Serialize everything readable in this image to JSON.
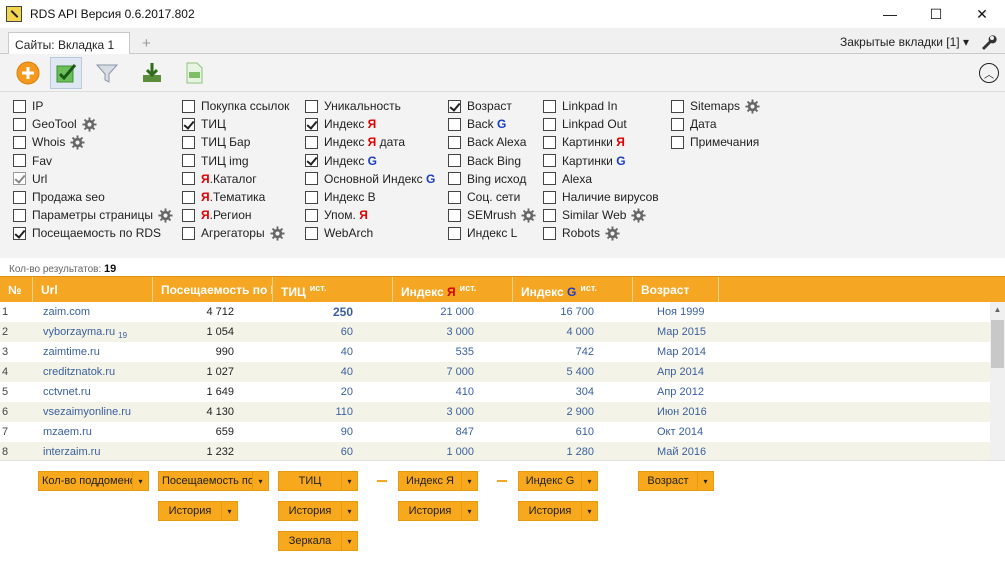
{
  "window": {
    "title": "RDS API Версия 0.6.2017.802",
    "minimize": "—",
    "maximize": "☐",
    "close": "✕"
  },
  "tabs": {
    "active": "Сайты:  Вкладка 1",
    "new_tab": "+",
    "closed_tabs": "Закрытые вкладки [1] ▾"
  },
  "options": {
    "col1": [
      {
        "label": "IP",
        "checked": false
      },
      {
        "label": "GeoTool",
        "checked": false,
        "gear": true
      },
      {
        "label": "Whois",
        "checked": false,
        "gear": true
      },
      {
        "label": "Fav",
        "checked": false
      },
      {
        "label": "Url",
        "checked": true,
        "disabled": true
      },
      {
        "label": "Продажа seo",
        "checked": false
      },
      {
        "label": "Параметры страницы",
        "checked": false,
        "gear": true
      },
      {
        "label": "Посещаемость по RDS",
        "checked": true
      }
    ],
    "col2": [
      {
        "label": "Покупка ссылок",
        "checked": false
      },
      {
        "label": "ТИЦ",
        "checked": true
      },
      {
        "label": "ТИЦ Бар",
        "checked": false
      },
      {
        "label": "ТИЦ img",
        "checked": false
      },
      {
        "pre_ya": "Я",
        "label": ".Каталог",
        "checked": false
      },
      {
        "pre_ya": "Я",
        "label": ".Тематика",
        "checked": false
      },
      {
        "pre_ya": "Я",
        "label": ".Регион",
        "checked": false
      },
      {
        "label": "Агрегаторы",
        "checked": false,
        "gear": true
      }
    ],
    "col3": [
      {
        "label": "Уникальность",
        "checked": false
      },
      {
        "label": "Индекс ",
        "ya": "Я",
        "checked": true
      },
      {
        "label": "Индекс ",
        "ya": "Я",
        "post": " дата",
        "checked": false
      },
      {
        "label": "Индекс ",
        "g": "G",
        "checked": true
      },
      {
        "label": "Основной Индекс ",
        "g": "G",
        "checked": false
      },
      {
        "label": "Индекс В",
        "checked": false
      },
      {
        "label": "Упом. ",
        "ya": "Я",
        "checked": false
      },
      {
        "label": "WebArch",
        "checked": false
      }
    ],
    "col4": [
      {
        "label": "Возраст",
        "checked": true
      },
      {
        "label": "Back ",
        "g": "G",
        "checked": false
      },
      {
        "label": "Back Alexa",
        "checked": false
      },
      {
        "label": "Back Bing",
        "checked": false
      },
      {
        "label": "Bing исход",
        "checked": false
      },
      {
        "label": "Соц. сети",
        "checked": false
      },
      {
        "label": "SEMrush",
        "checked": false,
        "gear": true
      },
      {
        "label": "Индекс L",
        "checked": false
      }
    ],
    "col5": [
      {
        "label": "Linkpad In",
        "checked": false
      },
      {
        "label": "Linkpad Out",
        "checked": false
      },
      {
        "label": "Картинки ",
        "ya": "Я",
        "checked": false
      },
      {
        "label": "Картинки ",
        "g": "G",
        "checked": false
      },
      {
        "label": "Alexa",
        "checked": false
      },
      {
        "label": "Наличие вирусов",
        "checked": false
      },
      {
        "label": "Similar Web",
        "checked": false,
        "gear": true
      },
      {
        "label": "Robots",
        "checked": false,
        "gear": true
      }
    ],
    "col6": [
      {
        "label": "Sitemaps",
        "checked": false,
        "gear": true
      },
      {
        "label": "Дата",
        "checked": false
      },
      {
        "label": "Примечания",
        "checked": false
      }
    ]
  },
  "results": {
    "label": "Кол-во результатов:",
    "count": "19"
  },
  "grid": {
    "headers": {
      "num": "№",
      "url": "Url",
      "visits": "Посещаемость по RDS",
      "tic": "ТИЦ",
      "tic_sup": "ист.",
      "iya": "Индекс ",
      "iya_ya": "Я",
      "iya_sup": "ист.",
      "ig": "Индекс ",
      "ig_g": "G",
      "ig_sup": "ист.",
      "age": "Возраст"
    },
    "rows": [
      {
        "n": "1",
        "url": "zaim.com",
        "visits": "4 712",
        "tic": "250",
        "iy": "21 000",
        "ig": "16 700",
        "age": "Ноя 1999"
      },
      {
        "n": "2",
        "url": "vyborzayma.ru",
        "url_sub": "19",
        "visits": "1 054",
        "tic": "60",
        "iy": "3 000",
        "ig": "4 000",
        "age": "Мар 2015"
      },
      {
        "n": "3",
        "url": "zaimtime.ru",
        "visits": "990",
        "tic": "40",
        "iy": "535",
        "ig": "742",
        "age": "Мар 2014"
      },
      {
        "n": "4",
        "url": "creditznatok.ru",
        "visits": "1 027",
        "tic": "40",
        "iy": "7 000",
        "ig": "5 400",
        "age": "Апр 2014"
      },
      {
        "n": "5",
        "url": "cctvnet.ru",
        "visits": "1 649",
        "tic": "20",
        "iy": "410",
        "ig": "304",
        "age": "Апр 2012"
      },
      {
        "n": "6",
        "url": "vsezaimyonline.ru",
        "visits": "4 130",
        "tic": "110",
        "iy": "3 000",
        "ig": "2 900",
        "age": "Июн 2016"
      },
      {
        "n": "7",
        "url": "mzaem.ru",
        "visits": "659",
        "tic": "90",
        "iy": "847",
        "ig": "610",
        "age": "Окт 2014"
      },
      {
        "n": "8",
        "url": "interzaim.ru",
        "visits": "1 232",
        "tic": "60",
        "iy": "1 000",
        "ig": "1 280",
        "age": "Май 2016"
      }
    ]
  },
  "controls": {
    "subdomains": "Кол-во поддоменов",
    "visits": "Посещаемость по RDS",
    "tic": "ТИЦ",
    "index_ya": "Индекс Я",
    "index_g": "Индекс G",
    "age": "Возраст",
    "history": "История",
    "mirrors": "Зеркала",
    "arrow": "▾"
  },
  "colors": {
    "accent": "#f5a623",
    "link": "#3a5f9e",
    "yandex": "#e00000",
    "google": "#1a3cc8"
  }
}
